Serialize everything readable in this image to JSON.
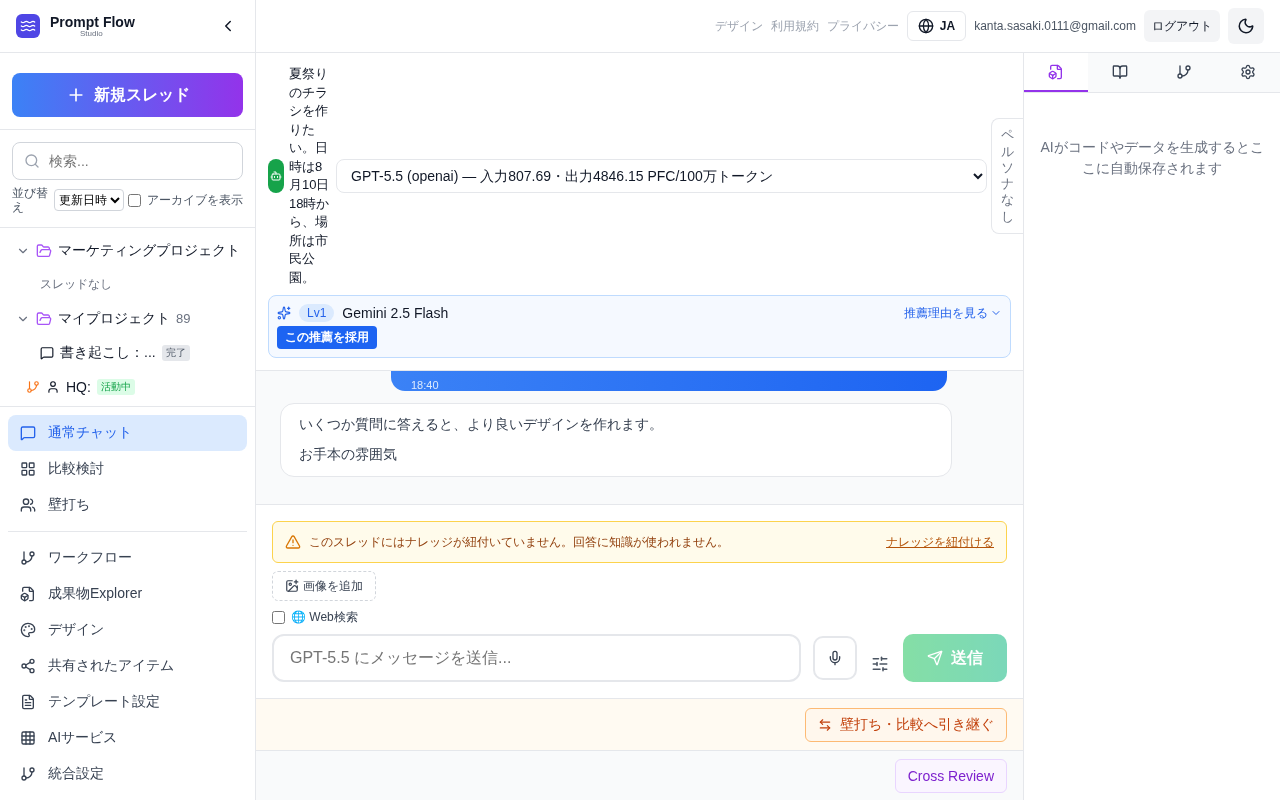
{
  "brand": {
    "name": "Prompt Flow",
    "subtitle": "Studio"
  },
  "new_thread_button": "新規スレッド",
  "search": {
    "placeholder": "検索..."
  },
  "sort": {
    "label": "並び替え",
    "value": "更新日時"
  },
  "archive_toggle": {
    "label": "アーカイブを表示",
    "checked": false
  },
  "projects": [
    {
      "name": "マーケティングプロジェクト",
      "expanded": true,
      "threads": [
        {
          "kind": "empty",
          "title": "スレッドなし"
        }
      ]
    },
    {
      "name": "マイプロジェクト",
      "count": "89",
      "expanded": true,
      "threads": [
        {
          "kind": "thread",
          "title": "書き起こし：...",
          "badge": {
            "kind": "done",
            "text": "完了"
          }
        },
        {
          "kind": "shared",
          "title": "HQ:",
          "badge": {
            "kind": "active",
            "text": "活動中"
          }
        }
      ]
    }
  ],
  "modes": [
    {
      "label": "通常チャット",
      "kind": "chat",
      "selected": true
    },
    {
      "label": "比較検討",
      "kind": "grid",
      "selected": false
    },
    {
      "label": "壁打ち",
      "kind": "users",
      "selected": false
    }
  ],
  "nav": [
    {
      "label": "ワークフロー",
      "kind": "branch"
    },
    {
      "label": "成果物Explorer",
      "kind": "filebox"
    },
    {
      "label": "デザイン",
      "kind": "palette"
    },
    {
      "label": "共有されたアイテム",
      "kind": "share"
    },
    {
      "label": "テンプレート設定",
      "kind": "file"
    },
    {
      "label": "AIサービス",
      "kind": "table"
    },
    {
      "label": "統合設定",
      "kind": "branch"
    }
  ],
  "topbar": {
    "links": [
      "デザイン",
      "利用規約",
      "プライバシー"
    ],
    "language": "JA",
    "email": "kanta.sasaki.0111@gmail.com",
    "logout": "ログアウト"
  },
  "chat_header": {
    "prompt": "夏祭りのチラシを作りたい。日時は8月10日18時から、場所は市民公園。",
    "model": "GPT-5.5 (openai) — 入力807.69・出力4846.15 PFC/100万トークン",
    "persona": "ペルソナなし"
  },
  "recommendation": {
    "level": "Lv1",
    "model": "Gemini 2.5 Flash",
    "reason_link": "推薦理由を見る",
    "adopt_button": "この推薦を採用"
  },
  "messages": [
    {
      "kind": "user",
      "time": "18:40"
    },
    {
      "kind": "assistant",
      "paragraphs": [
        "いくつか質問に答えると、より良いデザインを作れます。",
        "お手本の雰囲気"
      ]
    }
  ],
  "composer": {
    "warning": "このスレッドにはナレッジが紐付いていません。回答に知識が使われません。",
    "warning_link": "ナレッジを紐付ける",
    "add_image": "画像を追加",
    "web_search": {
      "label": "🌐 Web検索",
      "checked": false
    },
    "placeholder": "GPT-5.5 にメッセージを送信...",
    "send": "送信",
    "send_disabled": true
  },
  "handoff_button": "壁打ち・比較へ引き継ぐ",
  "cross_review_button": "Cross Review",
  "side_panel": {
    "tabs": [
      {
        "kind": "filebox",
        "selected": true
      },
      {
        "kind": "book",
        "selected": false
      },
      {
        "kind": "branch",
        "selected": false
      },
      {
        "kind": "settings",
        "selected": false
      }
    ],
    "empty_text": "AIがコードやデータを生成するとここに自動保存されます"
  }
}
